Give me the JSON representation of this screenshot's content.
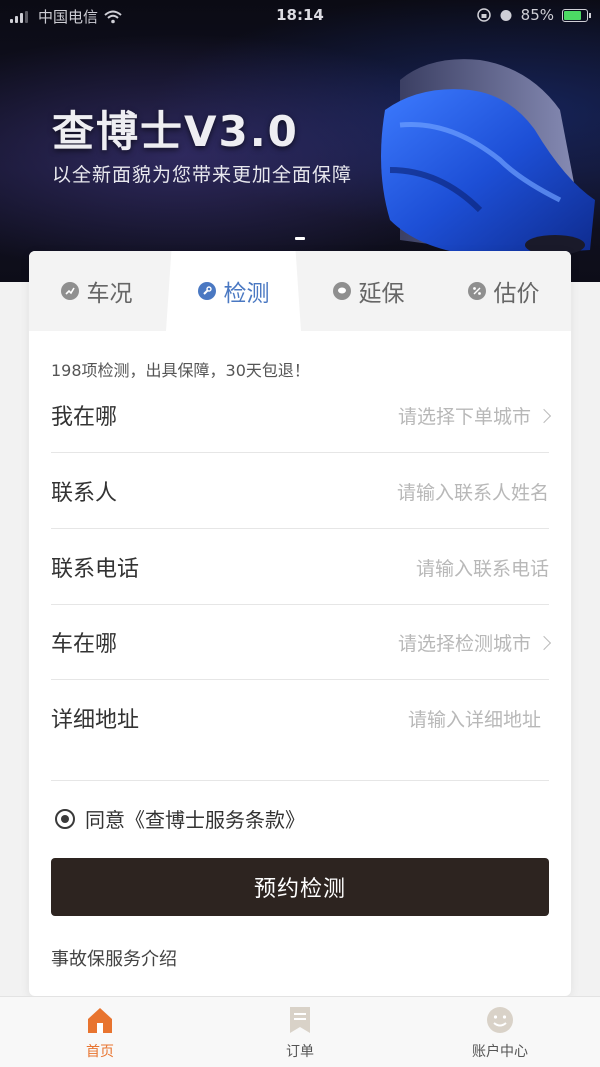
{
  "status_bar": {
    "carrier": "中国电信",
    "time": "18:14",
    "battery": "85%",
    "battery_level": 0.85
  },
  "banner": {
    "title": "查博士V3.0",
    "subtitle": "以全新面貌为您带来更加全面保障"
  },
  "tabs": [
    {
      "label": "车况",
      "icon": "chart-icon",
      "active": false
    },
    {
      "label": "检测",
      "icon": "wrench-icon",
      "active": true
    },
    {
      "label": "延保",
      "icon": "chat-icon",
      "active": false
    },
    {
      "label": "估价",
      "icon": "percent-icon",
      "active": false
    }
  ],
  "form": {
    "promo": "198项检测，出具保障，30天包退！",
    "rows": [
      {
        "label": "我在哪",
        "placeholder": "请选择下单城市",
        "has_arrow": true
      },
      {
        "label": "联系人",
        "placeholder": "请输入联系人姓名",
        "has_arrow": false
      },
      {
        "label": "联系电话",
        "placeholder": "请输入联系电话",
        "has_arrow": false
      },
      {
        "label": "车在哪",
        "placeholder": "请选择检测城市",
        "has_arrow": true
      },
      {
        "label": "详细地址",
        "placeholder": "请输入详细地址",
        "has_arrow": false
      }
    ],
    "agreement": "同意《查博士服务条款》",
    "submit_label": "预约检测",
    "intro_link": "事故保服务介绍"
  },
  "tabbar": [
    {
      "label": "首页",
      "icon": "home-icon",
      "active": true
    },
    {
      "label": "订单",
      "icon": "bookmark-icon",
      "active": false
    },
    {
      "label": "账户中心",
      "icon": "smiley-icon",
      "active": false
    }
  ],
  "colors": {
    "accent_tab": "#4a78c2",
    "accent_nav": "#e8742f",
    "button_bg": "#2d2420"
  }
}
